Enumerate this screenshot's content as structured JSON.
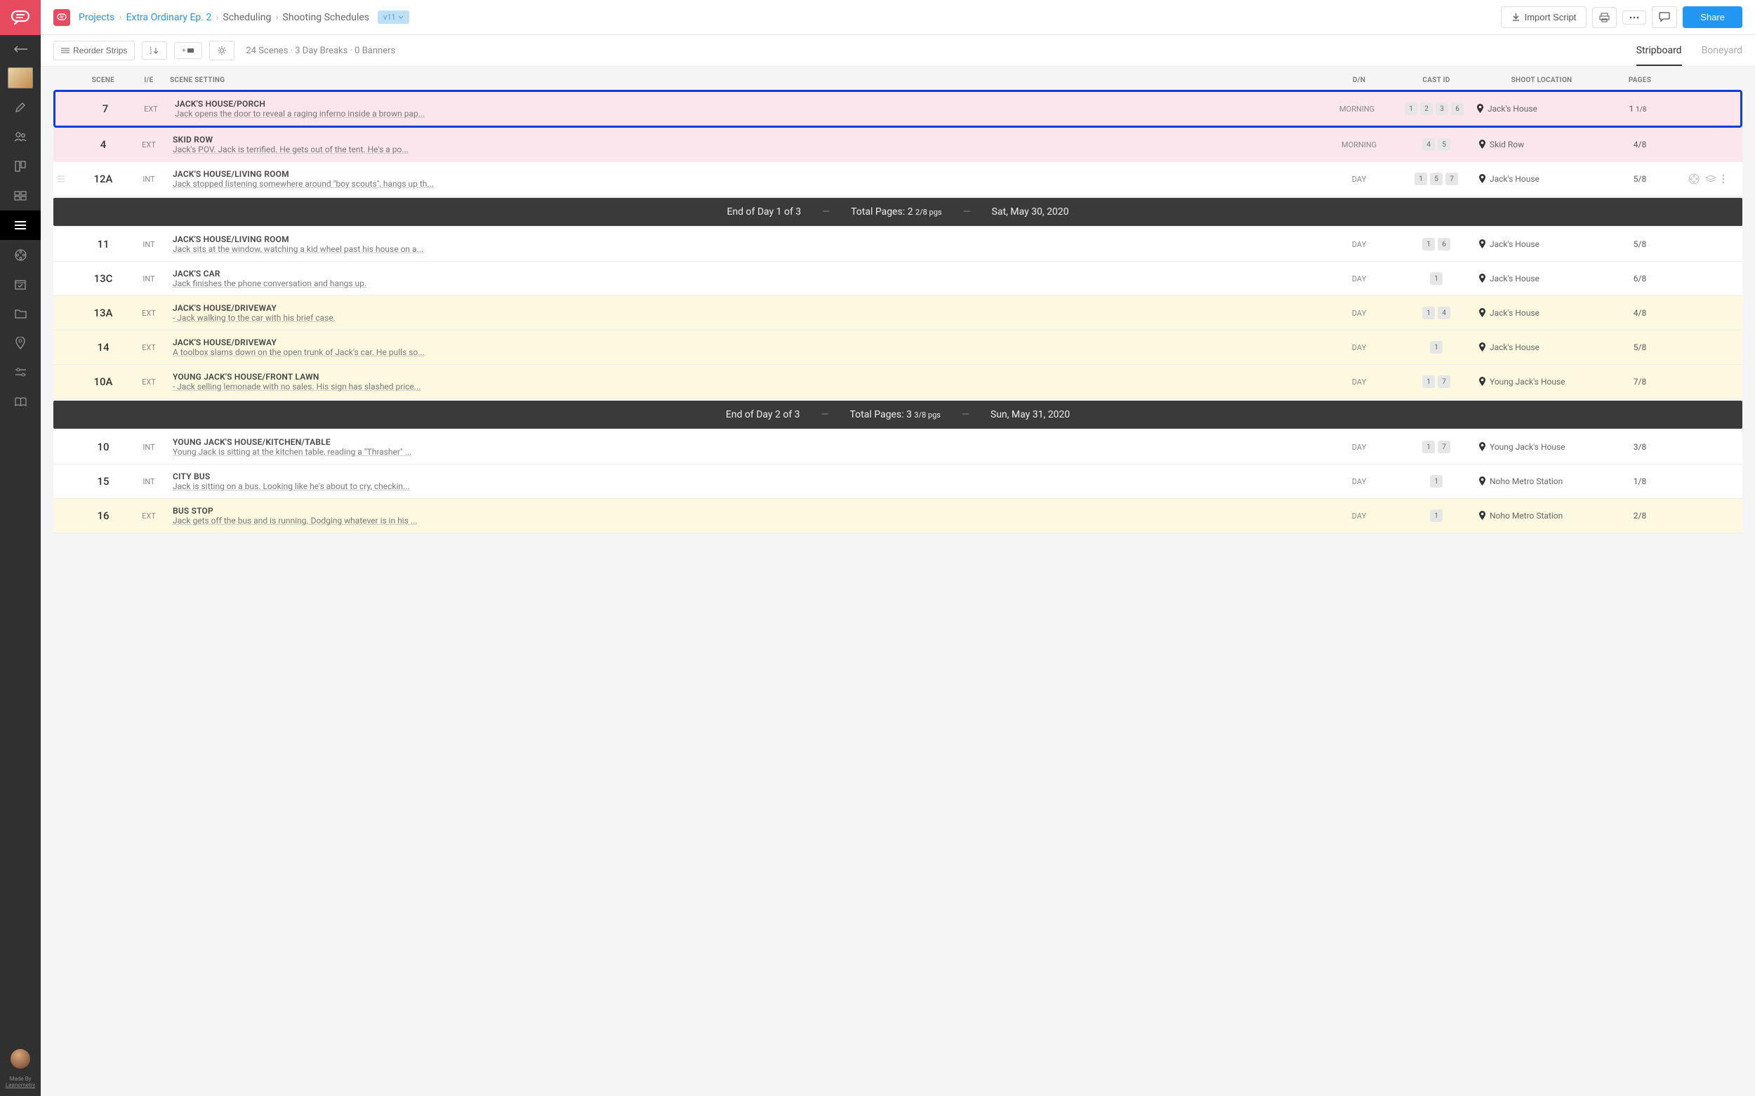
{
  "breadcrumb": {
    "projects": "Projects",
    "project": "Extra Ordinary Ep. 2",
    "scheduling": "Scheduling",
    "shooting": "Shooting Schedules",
    "version": "v11"
  },
  "topbar": {
    "import": "Import Script",
    "share": "Share"
  },
  "toolbar": {
    "reorder": "Reorder Strips",
    "stats": "24 Scenes · 3 Day Breaks · 0 Banners",
    "tab_stripboard": "Stripboard",
    "tab_boneyard": "Boneyard"
  },
  "columns": {
    "scene": "SCENE",
    "ie": "I/E",
    "setting": "SCENE SETTING",
    "dn": "D/N",
    "cast": "CAST ID",
    "loc": "SHOOT LOCATION",
    "pages": "PAGES"
  },
  "credit": {
    "line1": "Made By",
    "line2": "Leanometry"
  },
  "rows": [
    {
      "type": "strip",
      "selected": true,
      "mood": "morning",
      "scene": "7",
      "ie": "EXT",
      "title": "JACK'S HOUSE/PORCH",
      "desc": "Jack opens the door to reveal a raging inferno inside a brown pap...",
      "dn": "MORNING",
      "cast": [
        "1",
        "2",
        "3",
        "6"
      ],
      "loc": "Jack's House",
      "pages": "1",
      "frac": "1/8"
    },
    {
      "type": "strip",
      "mood": "morning",
      "scene": "4",
      "ie": "EXT",
      "title": "SKID ROW",
      "desc": "Jack's POV. Jack is terrified. He gets out of the tent. He's a po...",
      "dn": "MORNING",
      "cast": [
        "4",
        "5"
      ],
      "loc": "Skid Row",
      "pages": "4/8"
    },
    {
      "type": "strip",
      "hover": true,
      "scene": "12A",
      "ie": "INT",
      "title": "JACK'S HOUSE/LIVING ROOM",
      "desc": "Jack stopped listening somewhere around \"boy scouts\", hangs up th...",
      "dn": "DAY",
      "cast": [
        "1",
        "5",
        "7"
      ],
      "loc": "Jack's House",
      "pages": "5/8"
    },
    {
      "type": "daybreak",
      "label": "End of Day 1 of 3",
      "tp_label": "Total Pages:",
      "tp_whole": "2",
      "tp_frac": "2/8 pgs",
      "date": "Sat, May 30, 2020"
    },
    {
      "type": "strip",
      "scene": "11",
      "ie": "INT",
      "title": "JACK'S HOUSE/LIVING ROOM",
      "desc": "Jack sits at the window, watching a kid wheel past his house on a...",
      "dn": "DAY",
      "cast": [
        "1",
        "6"
      ],
      "loc": "Jack's House",
      "pages": "5/8"
    },
    {
      "type": "strip",
      "scene": "13C",
      "ie": "INT",
      "title": "JACK'S CAR",
      "desc": "Jack finishes the phone conversation and hangs up.",
      "dn": "DAY",
      "cast": [
        "1"
      ],
      "loc": "Jack's House",
      "pages": "6/8"
    },
    {
      "type": "strip",
      "mood": "ext-day",
      "scene": "13A",
      "ie": "EXT",
      "title": "JACK'S HOUSE/DRIVEWAY",
      "desc": "- Jack walking to the car with his brief case.",
      "dn": "DAY",
      "cast": [
        "1",
        "4"
      ],
      "loc": "Jack's House",
      "pages": "4/8"
    },
    {
      "type": "strip",
      "mood": "ext-day",
      "scene": "14",
      "ie": "EXT",
      "title": "JACK'S HOUSE/DRIVEWAY",
      "desc": "A toolbox slams down on the open trunk of Jack's car. He pulls so...",
      "dn": "DAY",
      "cast": [
        "1"
      ],
      "loc": "Jack's House",
      "pages": "5/8"
    },
    {
      "type": "strip",
      "mood": "ext-day",
      "scene": "10A",
      "ie": "EXT",
      "title": "YOUNG JACK'S HOUSE/FRONT LAWN",
      "desc": "- Jack selling lemonade with no sales. His sign has slashed price...",
      "dn": "DAY",
      "cast": [
        "1",
        "7"
      ],
      "loc": "Young Jack's House",
      "pages": "7/8"
    },
    {
      "type": "daybreak",
      "label": "End of Day 2 of 3",
      "tp_label": "Total Pages:",
      "tp_whole": "3",
      "tp_frac": "3/8 pgs",
      "date": "Sun, May 31, 2020"
    },
    {
      "type": "strip",
      "scene": "10",
      "ie": "INT",
      "title": "YOUNG JACK'S HOUSE/KITCHEN/TABLE",
      "desc": "Young Jack is sitting at the kitchen table, reading a \"Thrasher\" ...",
      "dn": "DAY",
      "cast": [
        "1",
        "7"
      ],
      "loc": "Young Jack's House",
      "pages": "3/8"
    },
    {
      "type": "strip",
      "scene": "15",
      "ie": "INT",
      "title": "CITY BUS",
      "desc": "Jack is sitting on a bus. Looking like he's about to cry, checkin...",
      "dn": "DAY",
      "cast": [
        "1"
      ],
      "loc": "Noho Metro Station",
      "pages": "1/8"
    },
    {
      "type": "strip",
      "mood": "ext-day",
      "scene": "16",
      "ie": "EXT",
      "title": "BUS STOP",
      "desc": "Jack gets off the bus and is running. Dodging whatever is in his ...",
      "dn": "DAY",
      "cast": [
        "1"
      ],
      "loc": "Noho Metro Station",
      "pages": "2/8"
    }
  ]
}
